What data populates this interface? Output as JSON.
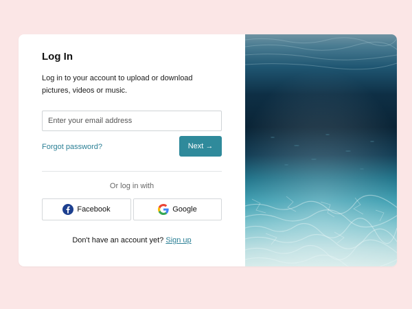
{
  "login": {
    "title": "Log In",
    "description": "Log in to your account to upload or download pictures, videos or music.",
    "email_placeholder": "Enter your email address",
    "email_value": "",
    "forgot_label": "Forgot password?",
    "next_label": "Next",
    "next_arrow": "→",
    "or_label": "Or log in with",
    "facebook_label": "Facebook",
    "google_label": "Google",
    "no_account_text": "Don't have an account yet?",
    "signup_label": "Sign up"
  },
  "colors": {
    "background": "#fbe6e6",
    "accent": "#2f8a9b",
    "link": "#2a7f95",
    "facebook_blue": "#1c3f8f"
  },
  "image": {
    "icon": "underwater-ocean-photo"
  }
}
